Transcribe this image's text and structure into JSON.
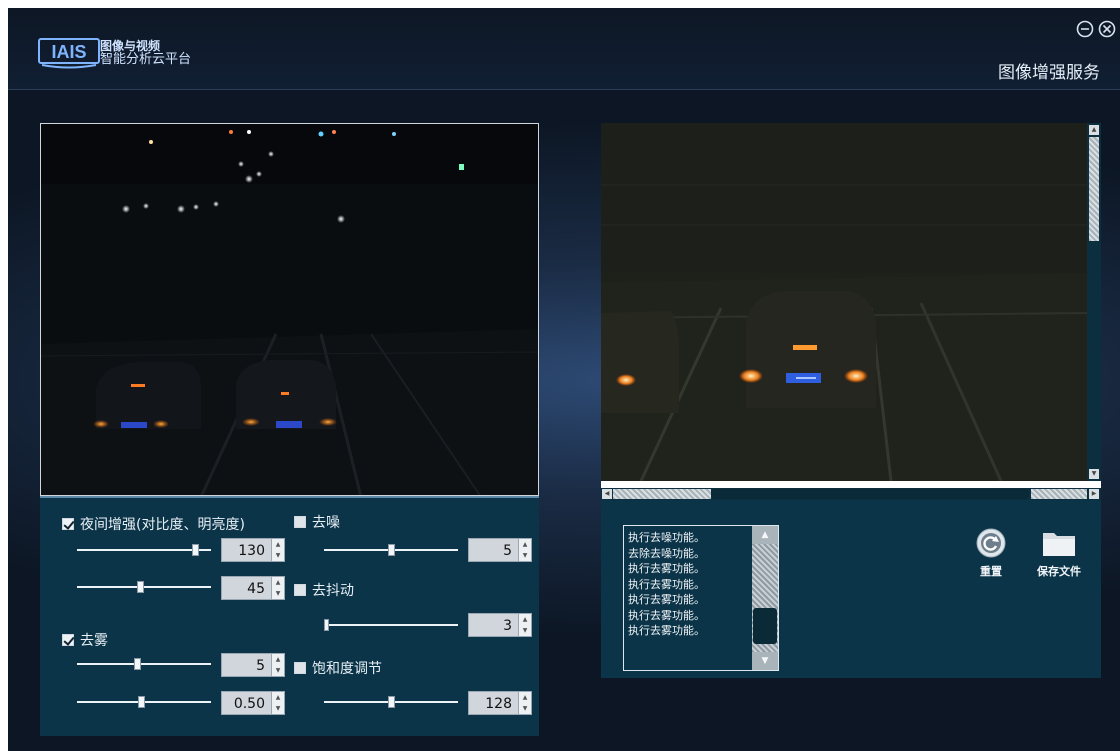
{
  "app": {
    "logo_text": "IAIS",
    "name_line1": "图像与视频",
    "name_line2": "智能分析云平台",
    "service_title": "图像增强服务"
  },
  "controls": {
    "night_enhance": {
      "label": "夜间增强(对比度、明亮度)",
      "checked": true
    },
    "contrast": {
      "value": "130",
      "level": 0.88
    },
    "brightness": {
      "value": "45",
      "level": 0.47
    },
    "denoise": {
      "label": "去噪",
      "checked": false,
      "value": "5",
      "level": 0.5
    },
    "deshake": {
      "label": "去抖动",
      "checked": false,
      "value": "3",
      "level": 0.0
    },
    "defog": {
      "label": "去雾",
      "checked": true
    },
    "defog_strength": {
      "value": "5",
      "level": 0.45
    },
    "defog_factor": {
      "value": "0.50",
      "level": 0.48
    },
    "saturation": {
      "label": "饱和度调节",
      "checked": false,
      "value": "128",
      "level": 0.5
    }
  },
  "log": {
    "lines": [
      "执行去噪功能。",
      "去除去噪功能。",
      "执行去雾功能。",
      "执行去雾功能。",
      "执行去雾功能。",
      "执行去雾功能。",
      "执行去雾功能。"
    ]
  },
  "actions": {
    "reset_label": "重置",
    "save_label": "保存文件"
  }
}
